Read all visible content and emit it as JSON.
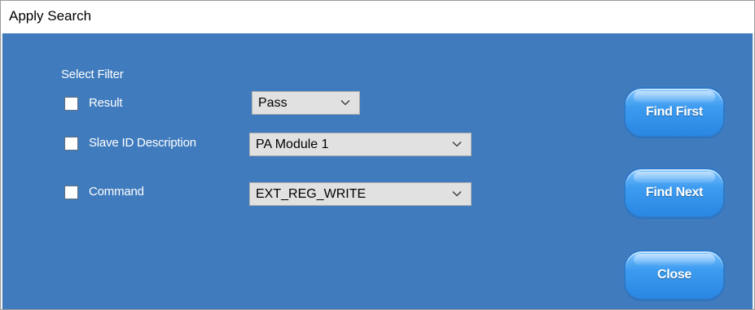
{
  "window": {
    "title": "Apply Search"
  },
  "filter": {
    "heading": "Select Filter",
    "rows": [
      {
        "label": "Result",
        "checked": false,
        "selected": "Pass"
      },
      {
        "label": "Slave ID Description",
        "checked": false,
        "selected": "PA Module 1"
      },
      {
        "label": "Command",
        "checked": false,
        "selected": "EXT_REG_WRITE"
      }
    ]
  },
  "buttons": {
    "find_first": "Find First",
    "find_next": "Find Next",
    "close": "Close"
  },
  "colors": {
    "panel": "#3f7bbd",
    "button": "#3d9cf0",
    "combo": "#e1e1e1"
  },
  "icons": {
    "dropdown": "chevron-down-icon"
  }
}
